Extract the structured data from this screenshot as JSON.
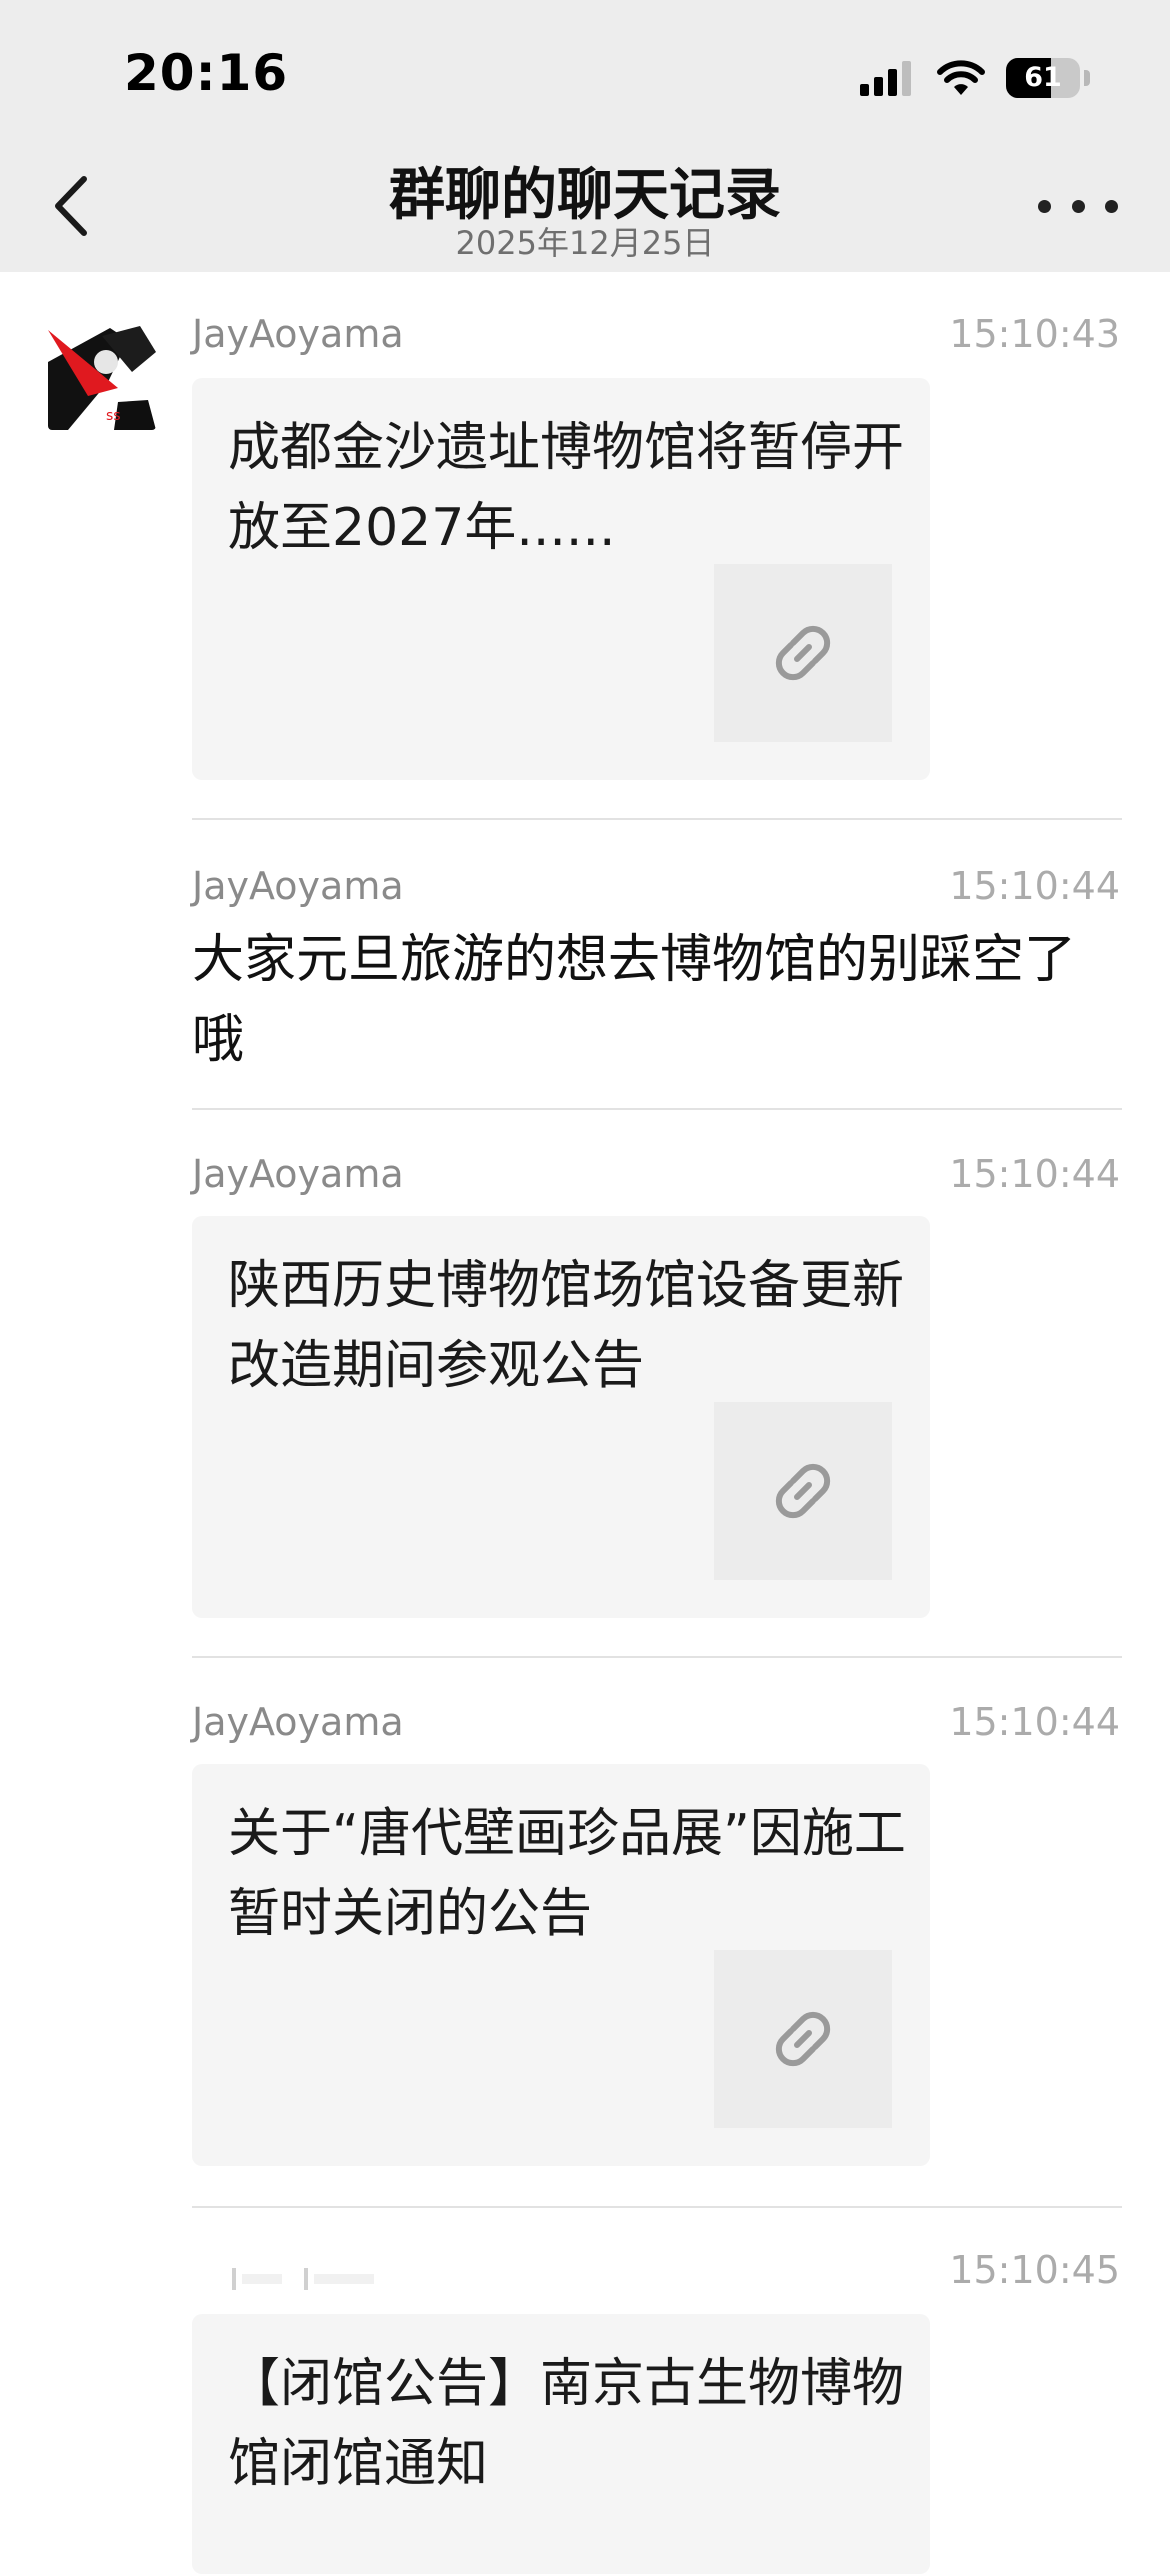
{
  "status_bar": {
    "time": "20:16",
    "battery_level": "61",
    "icons": [
      "cellular-signal-icon",
      "wifi-icon",
      "battery-icon"
    ]
  },
  "nav": {
    "back_icon": "chevron-left-icon",
    "title": "群聊的聊天记录",
    "subtitle": "2025年12月25日",
    "more_icon": "more-dots-icon"
  },
  "messages": [
    {
      "sender": "JayAoyama",
      "time": "15:10:43",
      "type": "link",
      "title": "成都金沙遗址博物馆将暂停开放至2027年......",
      "thumb_icon": "link-icon"
    },
    {
      "sender": "JayAoyama",
      "time": "15:10:44",
      "type": "text",
      "text": "大家元旦旅游的想去博物馆的别踩空了哦"
    },
    {
      "sender": "JayAoyama",
      "time": "15:10:44",
      "type": "link",
      "title": "陕西历史博物馆场馆设备更新改造期间参观公告",
      "thumb_icon": "link-icon"
    },
    {
      "sender": "JayAoyama",
      "time": "15:10:44",
      "type": "link",
      "title": "关于“唐代壁画珍品展”因施工暂时关闭的公告",
      "thumb_icon": "link-icon"
    },
    {
      "sender": "",
      "time": "15:10:45",
      "type": "link",
      "title": "【闭馆公告】南京古生物博物馆闭馆通知",
      "thumb_icon": "link-icon"
    }
  ],
  "colors": {
    "header_bg": "#ededed",
    "card_bg": "#f5f5f5",
    "sender_text": "#8a8a8a",
    "time_text": "#ababab",
    "avatar_accent": "#e0191f"
  }
}
